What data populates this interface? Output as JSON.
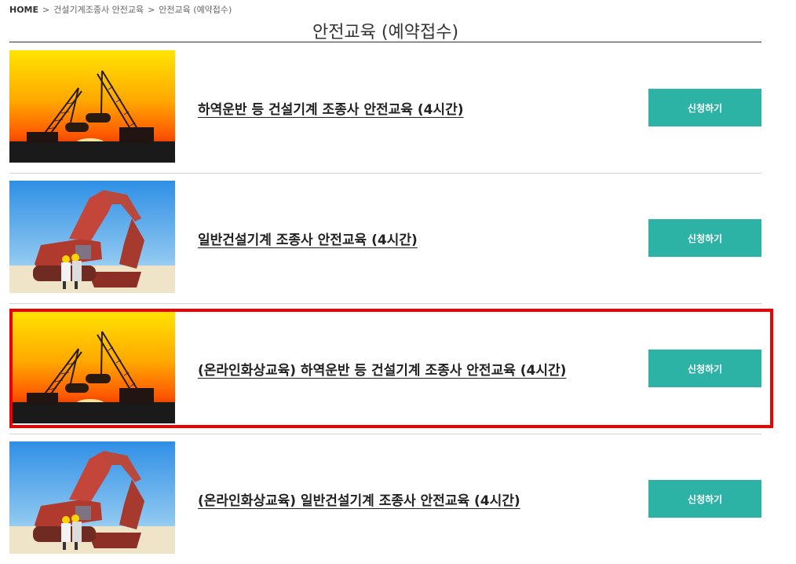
{
  "breadcrumb": {
    "home": "HOME",
    "separator": ">",
    "level1": "건설기계조종사 안전교육",
    "level2": "안전교육 (예약접수)"
  },
  "page_title": "안전교육 (예약접수)",
  "courses": [
    {
      "title": "하역운반 등 건설기계 조종사 안전교육 (4시간)",
      "button": "신청하기",
      "image": "crawler-crane-sunset-photo"
    },
    {
      "title": "일반건설기계 조종사 안전교육 (4시간)",
      "button": "신청하기",
      "image": "excavator-workers-photo"
    },
    {
      "title": "(온라인화상교육) 하역운반 등 건설기계 조종사 안전교육 (4시간)",
      "button": "신청하기",
      "image": "crawler-crane-sunset-photo"
    },
    {
      "title": "(온라인화상교육) 일반건설기계 조종사 안전교육 (4시간)",
      "button": "신청하기",
      "image": "excavator-workers-photo"
    }
  ],
  "colors": {
    "button": "#2db3a6",
    "highlight_border": "#ee0000"
  }
}
